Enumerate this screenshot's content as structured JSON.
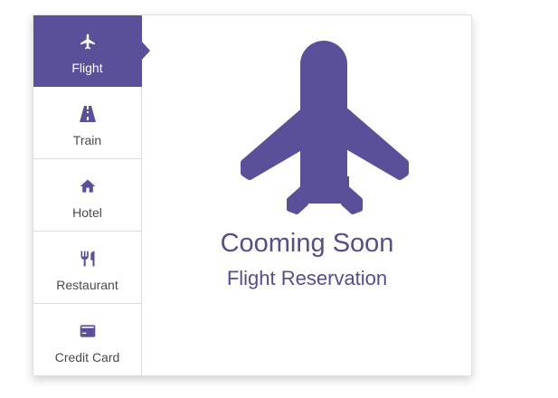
{
  "tabs": [
    {
      "label": "Flight",
      "icon": "airplane-icon",
      "active": true
    },
    {
      "label": "Train",
      "icon": "train-track-icon",
      "active": false
    },
    {
      "label": "Hotel",
      "icon": "home-icon",
      "active": false
    },
    {
      "label": "Restaurant",
      "icon": "fork-knife-icon",
      "active": false
    },
    {
      "label": "Credit Card",
      "icon": "credit-card-icon",
      "active": false
    }
  ],
  "content": {
    "icon": "airplane-icon",
    "title": "Cooming Soon",
    "subtitle": "Flight Reservation"
  },
  "colors": {
    "accent": "#5a5099",
    "text_accent": "#554d8c",
    "label": "#4a4a4a"
  }
}
